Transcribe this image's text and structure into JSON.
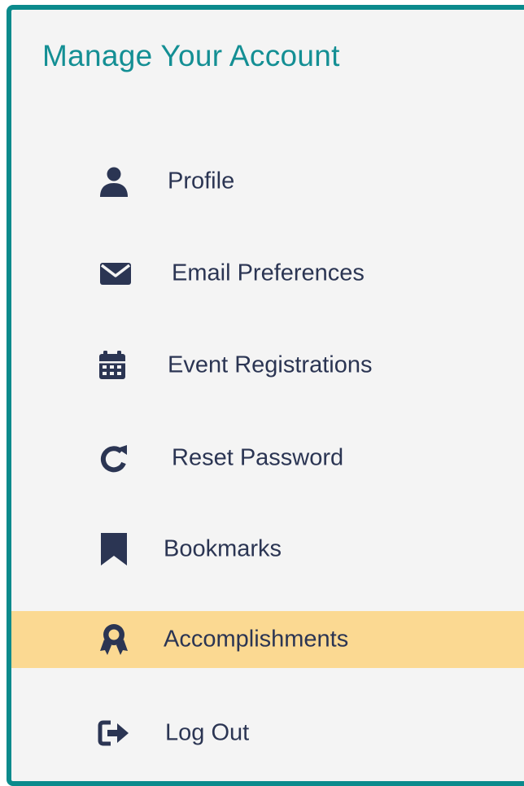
{
  "sidebar": {
    "title": "Manage Your Account",
    "items": [
      {
        "label": "Profile",
        "icon": "user-icon"
      },
      {
        "label": "Email Preferences",
        "icon": "envelope-icon"
      },
      {
        "label": "Event Registrations",
        "icon": "calendar-icon"
      },
      {
        "label": "Reset Password",
        "icon": "redo-icon"
      },
      {
        "label": "Bookmarks",
        "icon": "bookmark-icon"
      },
      {
        "label": "Accomplishments",
        "icon": "award-icon",
        "active": true
      },
      {
        "label": "Log Out",
        "icon": "sign-out-icon"
      }
    ]
  },
  "colors": {
    "border": "#0b8a8c",
    "title": "#148f94",
    "text": "#2b3553",
    "active_background": "#fbd992",
    "panel_background": "#f4f4f4"
  }
}
